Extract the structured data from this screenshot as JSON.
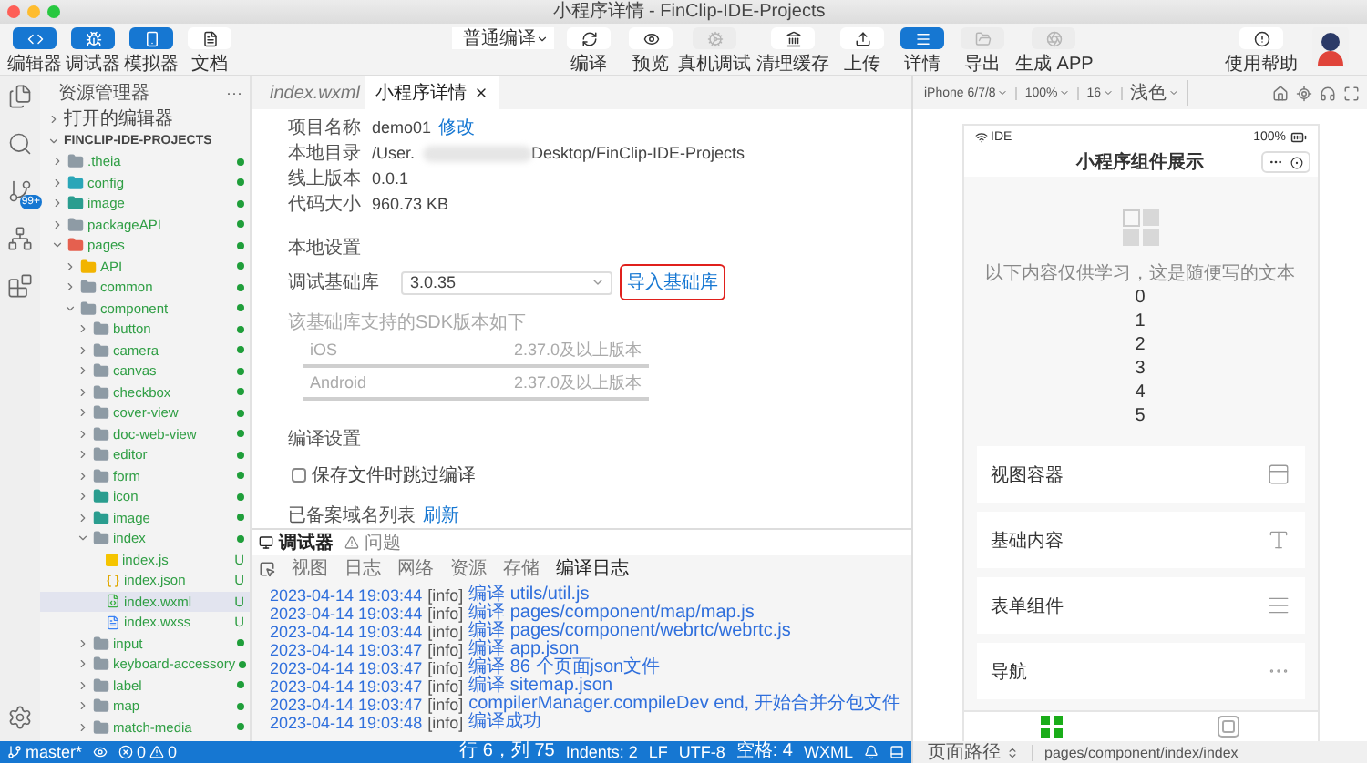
{
  "window": {
    "title": "小程序详情 - FinClip-IDE-Projects"
  },
  "toolbar": {
    "view_buttons": [
      {
        "label": "编辑器",
        "kind": "code",
        "selected": true
      },
      {
        "label": "调试器",
        "kind": "debug",
        "selected": true
      },
      {
        "label": "模拟器",
        "kind": "phone",
        "selected": true
      },
      {
        "label": "文档",
        "kind": "doc",
        "selected": false
      }
    ],
    "compile_mode": "普通编译",
    "compile_buttons": [
      {
        "label": "编译",
        "kind": "refresh"
      },
      {
        "label": "预览",
        "kind": "eye"
      }
    ],
    "actions": [
      {
        "label": "真机调试",
        "kind": "cog",
        "selected": false,
        "disabled": true
      },
      {
        "label": "清理缓存",
        "kind": "clean",
        "selected": false,
        "disabled": false
      },
      {
        "label": "上传",
        "kind": "upload",
        "selected": false,
        "disabled": false
      },
      {
        "label": "详情",
        "kind": "details",
        "selected": true,
        "disabled": false
      },
      {
        "label": "导出",
        "kind": "export",
        "selected": false,
        "disabled": true
      },
      {
        "label": "生成 APP",
        "kind": "app",
        "selected": false,
        "disabled": true
      }
    ],
    "help": "使用帮助"
  },
  "activity_bar": [
    {
      "kind": "files"
    },
    {
      "kind": "search"
    },
    {
      "kind": "source-control",
      "badge": "99+"
    },
    {
      "kind": "graph"
    },
    {
      "kind": "extensions"
    },
    {
      "kind": "settings"
    }
  ],
  "explorer": {
    "title": "资源管理器",
    "more": "···",
    "open_editors": "打开的编辑器",
    "project": "FINCLIP-IDE-PROJECTS",
    "tree": [
      {
        "name": ".theia",
        "kind": "folder",
        "color": "#8e9ba5",
        "expanded": false,
        "selected": false,
        "dot": true
      },
      {
        "name": "config",
        "kind": "folder",
        "color": "#2aa6b8",
        "expanded": false,
        "selected": false,
        "dot": true
      },
      {
        "name": "image",
        "kind": "folder",
        "color": "#2a9d8f",
        "expanded": false,
        "selected": false,
        "dot": true
      },
      {
        "name": "packageAPI",
        "kind": "folder",
        "color": "#8e9ba5",
        "expanded": false,
        "selected": false,
        "dot": true
      },
      {
        "name": "pages",
        "kind": "folder",
        "color": "#e5604f",
        "expanded": true,
        "selected": false,
        "dot": true,
        "children": [
          {
            "name": "API",
            "kind": "folder",
            "color": "#f2b400",
            "expanded": false,
            "selected": false,
            "dot": true
          },
          {
            "name": "common",
            "kind": "folder",
            "color": "#8e9ba5",
            "expanded": false,
            "selected": false,
            "dot": true
          },
          {
            "name": "component",
            "kind": "folder",
            "color": "#8e9ba5",
            "expanded": true,
            "selected": false,
            "dot": true,
            "children": [
              {
                "name": "button",
                "kind": "folder",
                "color": "#8e9ba5",
                "expanded": false,
                "selected": false,
                "dot": true
              },
              {
                "name": "camera",
                "kind": "folder",
                "color": "#8e9ba5",
                "expanded": false,
                "selected": false,
                "dot": true
              },
              {
                "name": "canvas",
                "kind": "folder",
                "color": "#8e9ba5",
                "expanded": false,
                "selected": false,
                "dot": true
              },
              {
                "name": "checkbox",
                "kind": "folder",
                "color": "#8e9ba5",
                "expanded": false,
                "selected": false,
                "dot": true
              },
              {
                "name": "cover-view",
                "kind": "folder",
                "color": "#8e9ba5",
                "expanded": false,
                "selected": false,
                "dot": true
              },
              {
                "name": "doc-web-view",
                "kind": "folder",
                "color": "#8e9ba5",
                "expanded": false,
                "selected": false,
                "dot": true
              },
              {
                "name": "editor",
                "kind": "folder",
                "color": "#8e9ba5",
                "expanded": false,
                "selected": false,
                "dot": true
              },
              {
                "name": "form",
                "kind": "folder",
                "color": "#8e9ba5",
                "expanded": false,
                "selected": false,
                "dot": true
              },
              {
                "name": "icon",
                "kind": "folder",
                "color": "#2a9d8f",
                "expanded": false,
                "selected": false,
                "dot": true
              },
              {
                "name": "image",
                "kind": "folder",
                "color": "#2a9d8f",
                "expanded": false,
                "selected": false,
                "dot": true
              },
              {
                "name": "index",
                "kind": "folder",
                "color": "#8e9ba5",
                "expanded": true,
                "selected": false,
                "dot": true,
                "children": [
                  {
                    "name": "index.js",
                    "kind": "js",
                    "selected": false,
                    "status_letter": "U"
                  },
                  {
                    "name": "index.json",
                    "kind": "json",
                    "selected": false,
                    "status_letter": "U"
                  },
                  {
                    "name": "index.wxml",
                    "kind": "wxml",
                    "selected": true,
                    "status_letter": "U"
                  },
                  {
                    "name": "index.wxss",
                    "kind": "wxss",
                    "selected": false,
                    "status_letter": "U"
                  }
                ]
              },
              {
                "name": "input",
                "kind": "folder",
                "color": "#8e9ba5",
                "expanded": false,
                "selected": false,
                "dot": true
              },
              {
                "name": "keyboard-accessory",
                "kind": "folder",
                "color": "#8e9ba5",
                "expanded": false,
                "selected": false,
                "dot": true
              },
              {
                "name": "label",
                "kind": "folder",
                "color": "#8e9ba5",
                "expanded": false,
                "selected": false,
                "dot": true
              },
              {
                "name": "map",
                "kind": "folder",
                "color": "#8e9ba5",
                "expanded": false,
                "selected": false,
                "dot": true
              },
              {
                "name": "match-media",
                "kind": "folder",
                "color": "#8e9ba5",
                "expanded": false,
                "selected": false,
                "dot": true
              }
            ]
          }
        ]
      }
    ]
  },
  "editor_tabs": [
    {
      "label": "index.wxml",
      "kind": "wxml",
      "preview": true,
      "selected": false
    },
    {
      "label": "小程序详情",
      "kind": "page",
      "preview": false,
      "selected": true
    }
  ],
  "details": {
    "project_info": [
      {
        "label": "项目名称",
        "value": "demo01",
        "link": "修改"
      },
      {
        "label": "本地目录",
        "value": "/User.",
        "redacted": true,
        "value_end": "Desktop/FinClip-IDE-Projects"
      },
      {
        "label": "线上版本",
        "value": "0.0.1"
      },
      {
        "label": "代码大小",
        "value": "960.73 KB"
      }
    ],
    "local_settings": {
      "title": "本地设置",
      "base_lib_label": "调试基础库",
      "base_lib_value": "3.0.35",
      "import_link": "导入基础库",
      "highlighted": true,
      "sdk_caption": "该基础库支持的SDK版本如下",
      "sdk_versions": [
        {
          "platform": "iOS",
          "version": "2.37.0及以上版本"
        },
        {
          "platform": "Android",
          "version": "2.37.0及以上版本"
        }
      ]
    },
    "compile_settings": {
      "title": "编译设置",
      "options": [
        {
          "label": "保存文件时跳过编译",
          "checked": false
        }
      ]
    },
    "domains": {
      "label": "已备案域名列表",
      "link": "刷新"
    }
  },
  "bottom_panel": {
    "tabs": [
      {
        "label": "调试器",
        "kind": "debugger",
        "selected": true
      },
      {
        "label": "问题",
        "kind": "problems",
        "selected": false
      }
    ],
    "subtabs": [
      {
        "label": "视图",
        "selected": false
      },
      {
        "label": "日志",
        "selected": false
      },
      {
        "label": "网络",
        "selected": false
      },
      {
        "label": "资源",
        "selected": false
      },
      {
        "label": "存储",
        "selected": false
      },
      {
        "label": "编译日志",
        "selected": true
      }
    ],
    "logs": [
      {
        "time": "2023-04-14 19:03:44",
        "level": "[info]",
        "message": "编译 utils/util.js"
      },
      {
        "time": "2023-04-14 19:03:44",
        "level": "[info]",
        "message": "编译 pages/component/map/map.js"
      },
      {
        "time": "2023-04-14 19:03:44",
        "level": "[info]",
        "message": "编译 pages/component/webrtc/webrtc.js"
      },
      {
        "time": "2023-04-14 19:03:47",
        "level": "[info]",
        "message": "编译 app.json"
      },
      {
        "time": "2023-04-14 19:03:47",
        "level": "[info]",
        "message": "编译 86 个页面json文件"
      },
      {
        "time": "2023-04-14 19:03:47",
        "level": "[info]",
        "message": "编译 sitemap.json"
      },
      {
        "time": "2023-04-14 19:03:47",
        "level": "[info]",
        "message": "compilerManager.compileDev end, 开始合并分包文件"
      },
      {
        "time": "2023-04-14 19:03:48",
        "level": "[info]",
        "message": "编译成功"
      }
    ]
  },
  "status_bar": {
    "branch": "master*",
    "errors": "0",
    "warnings": "0",
    "items": [
      "行 6，列 75",
      "Indents: 2",
      "LF",
      "UTF-8",
      "空格: 4",
      "WXML"
    ]
  },
  "simulator": {
    "settings": [
      "iPhone 6/7/8",
      "100%",
      "16",
      "浅色"
    ],
    "tools": [
      {
        "kind": "home"
      },
      {
        "kind": "location"
      },
      {
        "kind": "audio"
      },
      {
        "kind": "fullscreen"
      }
    ],
    "phone": {
      "carrier": "IDE",
      "battery": "100%",
      "nav_title": "小程序组件展示",
      "intro": "以下内容仅供学习，这是随便写的文本",
      "numbers": [
        "0",
        "1",
        "2",
        "3",
        "4",
        "5"
      ],
      "menu": [
        {
          "label": "视图容器",
          "kind": "view"
        },
        {
          "label": "基础内容",
          "kind": "text"
        },
        {
          "label": "表单组件",
          "kind": "form"
        },
        {
          "label": "导航",
          "kind": "nav"
        }
      ],
      "tabbar": [
        {
          "kind": "component",
          "selected": true
        },
        {
          "kind": "api",
          "selected": false
        }
      ]
    },
    "page_path": {
      "label": "页面路径",
      "value": "pages/component/index/index"
    }
  }
}
